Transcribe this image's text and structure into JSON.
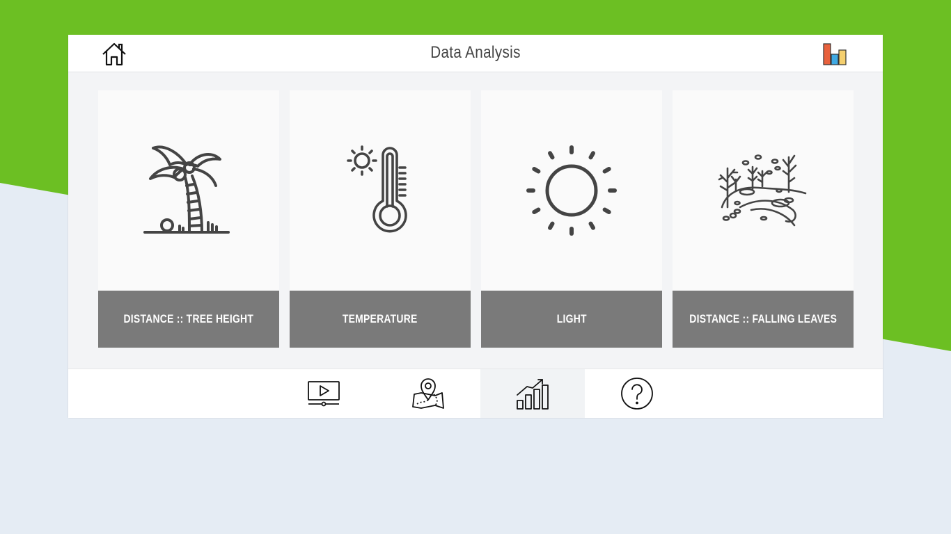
{
  "page": {
    "title": "Data Analysis",
    "colors": {
      "green": "#6cbf23",
      "background": "#e5ecf4",
      "label_bar": "#7a7a7a",
      "icon": "#444444"
    }
  },
  "header": {
    "home_icon": "home-icon",
    "chart_icon": "bar-chart-icon"
  },
  "cards": [
    {
      "label": "DISTANCE :: TREE HEIGHT",
      "icon": "palm-tree-icon"
    },
    {
      "label": "TEMPERATURE",
      "icon": "thermometer-icon"
    },
    {
      "label": "LIGHT",
      "icon": "sun-icon"
    },
    {
      "label": "DISTANCE :: FALLING LEAVES",
      "icon": "landscape-leaves-icon"
    }
  ],
  "footer": {
    "nav": [
      {
        "icon": "video-player-icon",
        "active": false
      },
      {
        "icon": "map-location-icon",
        "active": false
      },
      {
        "icon": "growth-chart-icon",
        "active": true
      },
      {
        "icon": "help-icon",
        "active": false
      }
    ]
  }
}
